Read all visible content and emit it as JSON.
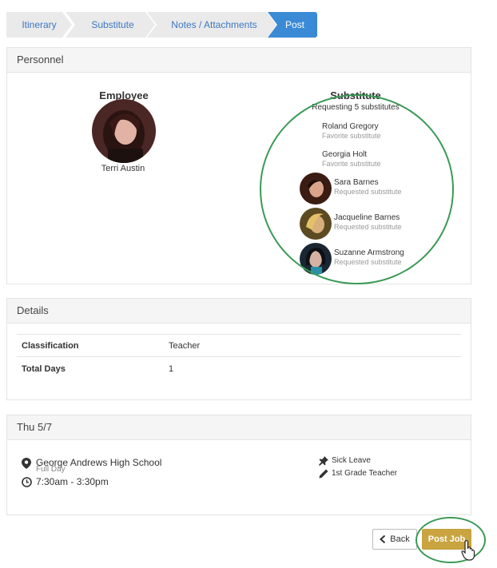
{
  "steps": [
    {
      "label": "Itinerary",
      "active": false
    },
    {
      "label": "Substitute",
      "active": false
    },
    {
      "label": "Notes / Attachments",
      "active": false
    },
    {
      "label": "Post",
      "active": true
    }
  ],
  "personnel": {
    "heading": "Personnel",
    "employee_title": "Employee",
    "employee_name": "Terri Austin",
    "substitute_title": "Substitute",
    "substitute_request": "Requesting 5 substitutes",
    "substitutes": [
      {
        "name": "Roland Gregory",
        "role": "Favorite substitute",
        "has_photo": false
      },
      {
        "name": "Georgia Holt",
        "role": "Favorite substitute",
        "has_photo": false
      },
      {
        "name": "Sara Barnes",
        "role": "Requested substitute",
        "has_photo": true
      },
      {
        "name": "Jacqueline Barnes",
        "role": "Requested substitute",
        "has_photo": true
      },
      {
        "name": "Suzanne Armstrong",
        "role": "Requested substitute",
        "has_photo": true
      }
    ]
  },
  "details": {
    "heading": "Details",
    "rows": [
      {
        "label": "Classification",
        "value": "Teacher"
      },
      {
        "label": "Total Days",
        "value": "1"
      }
    ]
  },
  "day": {
    "heading": "Thu 5/7",
    "location": "George Andrews High School",
    "time": "7:30am - 3:30pm",
    "duration": "Full Day",
    "reason": "Sick Leave",
    "position": "1st Grade Teacher"
  },
  "actions": {
    "back_label": "Back",
    "post_label": "Post Job"
  },
  "colors": {
    "link_blue": "#3c78c3",
    "active_step": "#3b8ad6",
    "post_button": "#c9a441",
    "highlight_ring": "#3a9a57"
  }
}
